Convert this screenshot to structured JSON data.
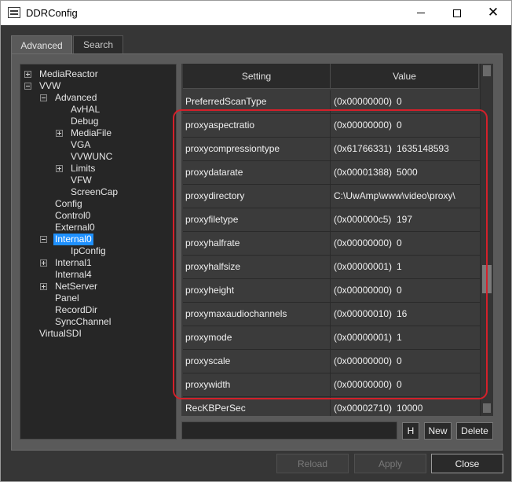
{
  "window": {
    "title": "DDRConfig",
    "icon": "app-icon",
    "controls": {
      "minimize": "minimize-icon",
      "maximize": "maximize-icon",
      "close": "✕"
    }
  },
  "tabs": [
    {
      "label": "Advanced",
      "active": true
    },
    {
      "label": "Search",
      "active": false
    }
  ],
  "tree": {
    "nodes": [
      {
        "label": "MediaReactor",
        "expander": "plus"
      },
      {
        "label": "VVW",
        "expander": "minus"
      },
      {
        "label": "Advanced",
        "expander": "minus"
      },
      {
        "label": "AvHAL",
        "expander": ""
      },
      {
        "label": "Debug",
        "expander": ""
      },
      {
        "label": "MediaFile",
        "expander": "plus"
      },
      {
        "label": "VGA",
        "expander": ""
      },
      {
        "label": "VVWUNC",
        "expander": ""
      },
      {
        "label": "Limits",
        "expander": "plus"
      },
      {
        "label": "VFW",
        "expander": ""
      },
      {
        "label": "ScreenCap",
        "expander": ""
      },
      {
        "label": "Config",
        "expander": ""
      },
      {
        "label": "Control0",
        "expander": ""
      },
      {
        "label": "External0",
        "expander": ""
      },
      {
        "label": "Internal0",
        "expander": "minus",
        "selected": true
      },
      {
        "label": "IpConfig",
        "expander": ""
      },
      {
        "label": "Internal1",
        "expander": "plus"
      },
      {
        "label": "Internal4",
        "expander": ""
      },
      {
        "label": "NetServer",
        "expander": "plus"
      },
      {
        "label": "Panel",
        "expander": ""
      },
      {
        "label": "RecordDir",
        "expander": ""
      },
      {
        "label": "SyncChannel",
        "expander": ""
      },
      {
        "label": "VirtualSDI",
        "expander": ""
      }
    ]
  },
  "grid": {
    "headers": {
      "setting": "Setting",
      "value": "Value"
    },
    "rows": [
      {
        "name": "PreferredScanType",
        "hex": "(0x00000000)",
        "value": "0"
      },
      {
        "name": "proxyaspectratio",
        "hex": "(0x00000000)",
        "value": "0"
      },
      {
        "name": "proxycompressiontype",
        "hex": "(0x61766331)",
        "value": "1635148593"
      },
      {
        "name": "proxydatarate",
        "hex": "(0x00001388)",
        "value": "5000"
      },
      {
        "name": "proxydirectory",
        "hex": "",
        "value": "C:\\UwAmp\\www\\video\\proxy\\"
      },
      {
        "name": "proxyfiletype",
        "hex": "(0x000000c5)",
        "value": "197"
      },
      {
        "name": "proxyhalfrate",
        "hex": "(0x00000000)",
        "value": "0"
      },
      {
        "name": "proxyhalfsize",
        "hex": "(0x00000001)",
        "value": "1"
      },
      {
        "name": "proxyheight",
        "hex": "(0x00000000)",
        "value": "0"
      },
      {
        "name": "proxymaxaudiochannels",
        "hex": "(0x00000010)",
        "value": "16"
      },
      {
        "name": "proxymode",
        "hex": "(0x00000001)",
        "value": "1"
      },
      {
        "name": "proxyscale",
        "hex": "(0x00000000)",
        "value": "0"
      },
      {
        "name": "proxywidth",
        "hex": "(0x00000000)",
        "value": "0"
      },
      {
        "name": "RecKBPerSec",
        "hex": "(0x00002710)",
        "value": "10000"
      }
    ]
  },
  "editor": {
    "value": ""
  },
  "buttons": {
    "h": "H",
    "new": "New",
    "delete": "Delete",
    "reload": "Reload",
    "apply": "Apply",
    "close": "Close"
  },
  "colors": {
    "selection": "#1e90ff",
    "highlight": "#d4202a"
  }
}
